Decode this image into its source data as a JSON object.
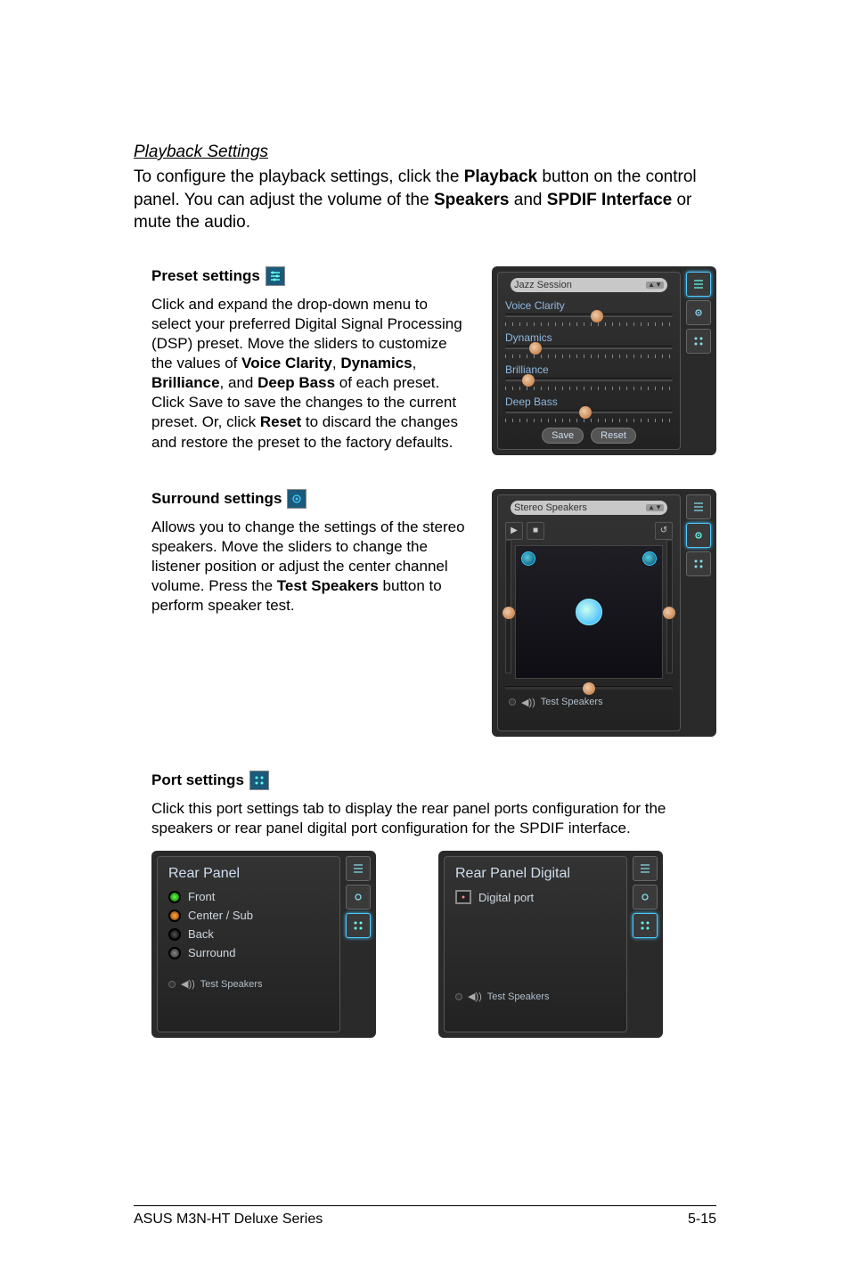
{
  "headings": {
    "playback": "Playback Settings",
    "preset": "Preset settings",
    "surround": "Surround settings",
    "port": "Port settings"
  },
  "playback_desc": {
    "pre": "To configure the playback settings, click the ",
    "b1": "Playback",
    "mid1": " button on the control panel. You can adjust the volume of the ",
    "b2": "Speakers",
    "mid2": " and ",
    "b3": "SPDIF Interface",
    "post": " or mute the audio."
  },
  "preset_desc": {
    "t1": "Click and expand the drop-down menu to select your preferred Digital Signal Processing (DSP) preset. Move the sliders to customize the values of ",
    "b1": "Voice Clarity",
    "t2": ", ",
    "b2": "Dynamics",
    "t3": ", ",
    "b3": "Brilliance",
    "t4": ", and ",
    "b4": "Deep Bass",
    "t5": " of each preset. Click Save to save the changes to the current preset. Or, click ",
    "b5": "Reset",
    "t6": " to discard the changes and restore the preset to the factory defaults."
  },
  "surround_desc": {
    "t1": "Allows you to change the settings of the stereo speakers. Move the sliders to change the listener position or adjust the center channel volume. Press the ",
    "b1": "Test Speakers",
    "t2": " button to perform speaker test."
  },
  "port_desc": "Click this port settings tab to display the rear panel ports configuration for the speakers or rear panel digital port configuration for the SPDIF interface.",
  "preset_panel": {
    "dropdown": "Jazz Session",
    "sliders": [
      {
        "label": "Voice Clarity",
        "pos": 55
      },
      {
        "label": "Dynamics",
        "pos": 18
      },
      {
        "label": "Brilliance",
        "pos": 14
      },
      {
        "label": "Deep Bass",
        "pos": 48
      }
    ],
    "save": "Save",
    "reset": "Reset"
  },
  "surround_panel": {
    "dropdown": "Stereo Speakers",
    "test": "Test Speakers"
  },
  "port_panel_a": {
    "title": "Rear Panel",
    "rows": [
      "Front",
      "Center / Sub",
      "Back",
      "Surround"
    ],
    "test": "Test Speakers"
  },
  "port_panel_b": {
    "title": "Rear Panel Digital",
    "row": "Digital port",
    "test": "Test Speakers"
  },
  "footer": {
    "left": "ASUS M3N-HT Deluxe Series",
    "right": "5-15"
  }
}
